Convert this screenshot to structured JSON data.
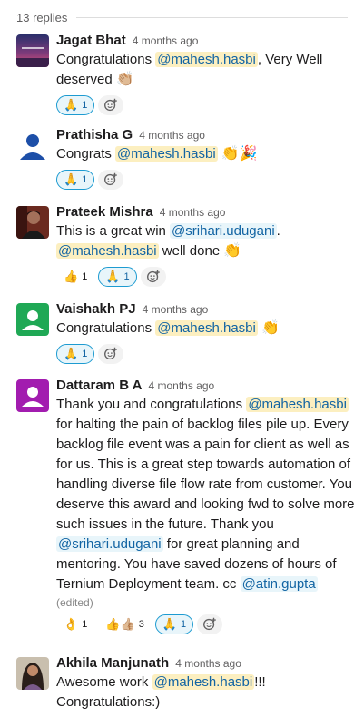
{
  "thread": {
    "replies_label": "13 replies"
  },
  "colors": {
    "mention_bg": "#fcefc0",
    "mention_fg": "#1264a3",
    "reaction_mine_border": "#1d9bd1"
  },
  "messages": [
    {
      "name": "Jagat Bhat",
      "time": "4 months ago",
      "avatar_icon": "sunset-photo-avatar",
      "text_1": "Congratulations ",
      "mention_1": "@mahesh.hasbi",
      "text_2": ", Very Well deserved ",
      "emoji_1": "👏🏼",
      "reactions": [
        {
          "emoji": "🙏",
          "count": "1",
          "mine": true
        }
      ]
    },
    {
      "name": "Prathisha G",
      "time": "4 months ago",
      "avatar_icon": "default-user-avatar",
      "text_1": "Congrats ",
      "mention_1": "@mahesh.hasbi",
      "emoji_1": "👏🎉",
      "reactions": [
        {
          "emoji": "🙏",
          "count": "1",
          "mine": true
        }
      ]
    },
    {
      "name": "Prateek Mishra",
      "time": "4 months ago",
      "avatar_icon": "person-photo-avatar",
      "text_1": "This is a great win ",
      "mention_1": "@srihari.udugani",
      "text_2": ".",
      "mention_2": "@mahesh.hasbi",
      "text_3": " well done ",
      "emoji_1": "👏",
      "reactions": [
        {
          "emoji": "👍",
          "count": "1",
          "mine": false
        },
        {
          "emoji": "🙏",
          "count": "1",
          "mine": true
        }
      ]
    },
    {
      "name": "Vaishakh PJ",
      "time": "4 months ago",
      "avatar_icon": "green-default-avatar",
      "text_1": "Congratulations ",
      "mention_1": "@mahesh.hasbi",
      "emoji_1": "👏",
      "reactions": [
        {
          "emoji": "🙏",
          "count": "1",
          "mine": true
        }
      ]
    },
    {
      "name": "Dattaram B A",
      "time": "4 months ago",
      "avatar_icon": "purple-default-avatar",
      "text_1": "Thank you and congratulations ",
      "mention_1": "@mahesh.hasbi",
      "text_2": " for halting the pain of backlog files pile up. Every backlog file event was a pain for client as well as for us. This is a great step towards automation of handling diverse file flow rate from customer. You deserve this award and looking fwd to solve more such issues in the future. Thank you ",
      "mention_2": "@srihari.udugani",
      "text_3": " for great planning and mentoring. You have saved dozens of hours of Ternium Deployment team. cc ",
      "mention_3": "@atin.gupta",
      "edited": "(edited)",
      "reactions": [
        {
          "emoji": "👌",
          "count": "1",
          "mine": false
        },
        {
          "emoji": "👍👍🏼",
          "count": "3",
          "mine": false
        },
        {
          "emoji": "🙏",
          "count": "1",
          "mine": true
        }
      ]
    },
    {
      "name": "Akhila Manjunath",
      "time": "4 months ago",
      "avatar_icon": "woman-photo-avatar",
      "text_1": "Awesome work ",
      "mention_1": "@mahesh.hasbi",
      "text_2": "!!! Congratulations:)"
    }
  ]
}
